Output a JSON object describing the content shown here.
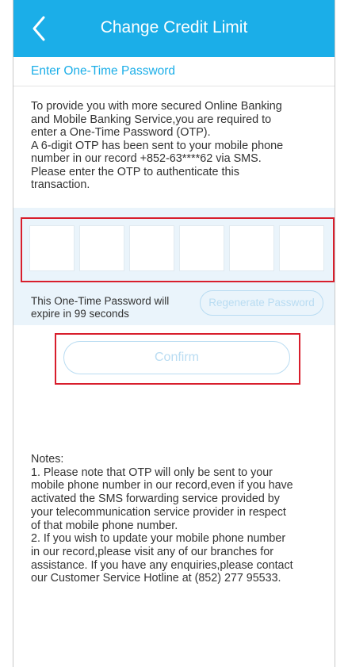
{
  "header": {
    "title": "Change Credit Limit",
    "back_icon": "chevron-left-icon",
    "background_color": "#1baee8"
  },
  "otp_section": {
    "title": "Enter One-Time Password",
    "description": "To provide you with more secured Online Banking\nand Mobile Banking Service,you are required to\nenter a One-Time Password (OTP).\nA 6-digit OTP has been sent to your mobile phone\nnumber in our record  +852-63****62 via SMS.\nPlease enter the OTP to authenticate this\ntransaction.",
    "digits": [
      "",
      "",
      "",
      "",
      "",
      ""
    ],
    "expire_text": "This One-Time Password will\nexpire in  99 seconds",
    "regenerate_label": "Regenerate Password"
  },
  "confirm_label": "Confirm",
  "notes": "Notes:\n1. Please note that OTP will only be sent to your\nmobile phone number in our record,even if you have\nactivated the SMS forwarding service provided by\nyour telecommunication service provider in respect\nof that mobile phone number.\n2. If you wish to update your mobile phone number\nin our record,please visit any of our branches for\nassistance. If you have any enquiries,please contact\nour Customer Service Hotline at (852) 277 95533.",
  "colors": {
    "accent": "#1baee8",
    "highlight": "#d81e2c",
    "disabled_button": "#b9dcf2",
    "otp_band": "#eaf4fb"
  }
}
